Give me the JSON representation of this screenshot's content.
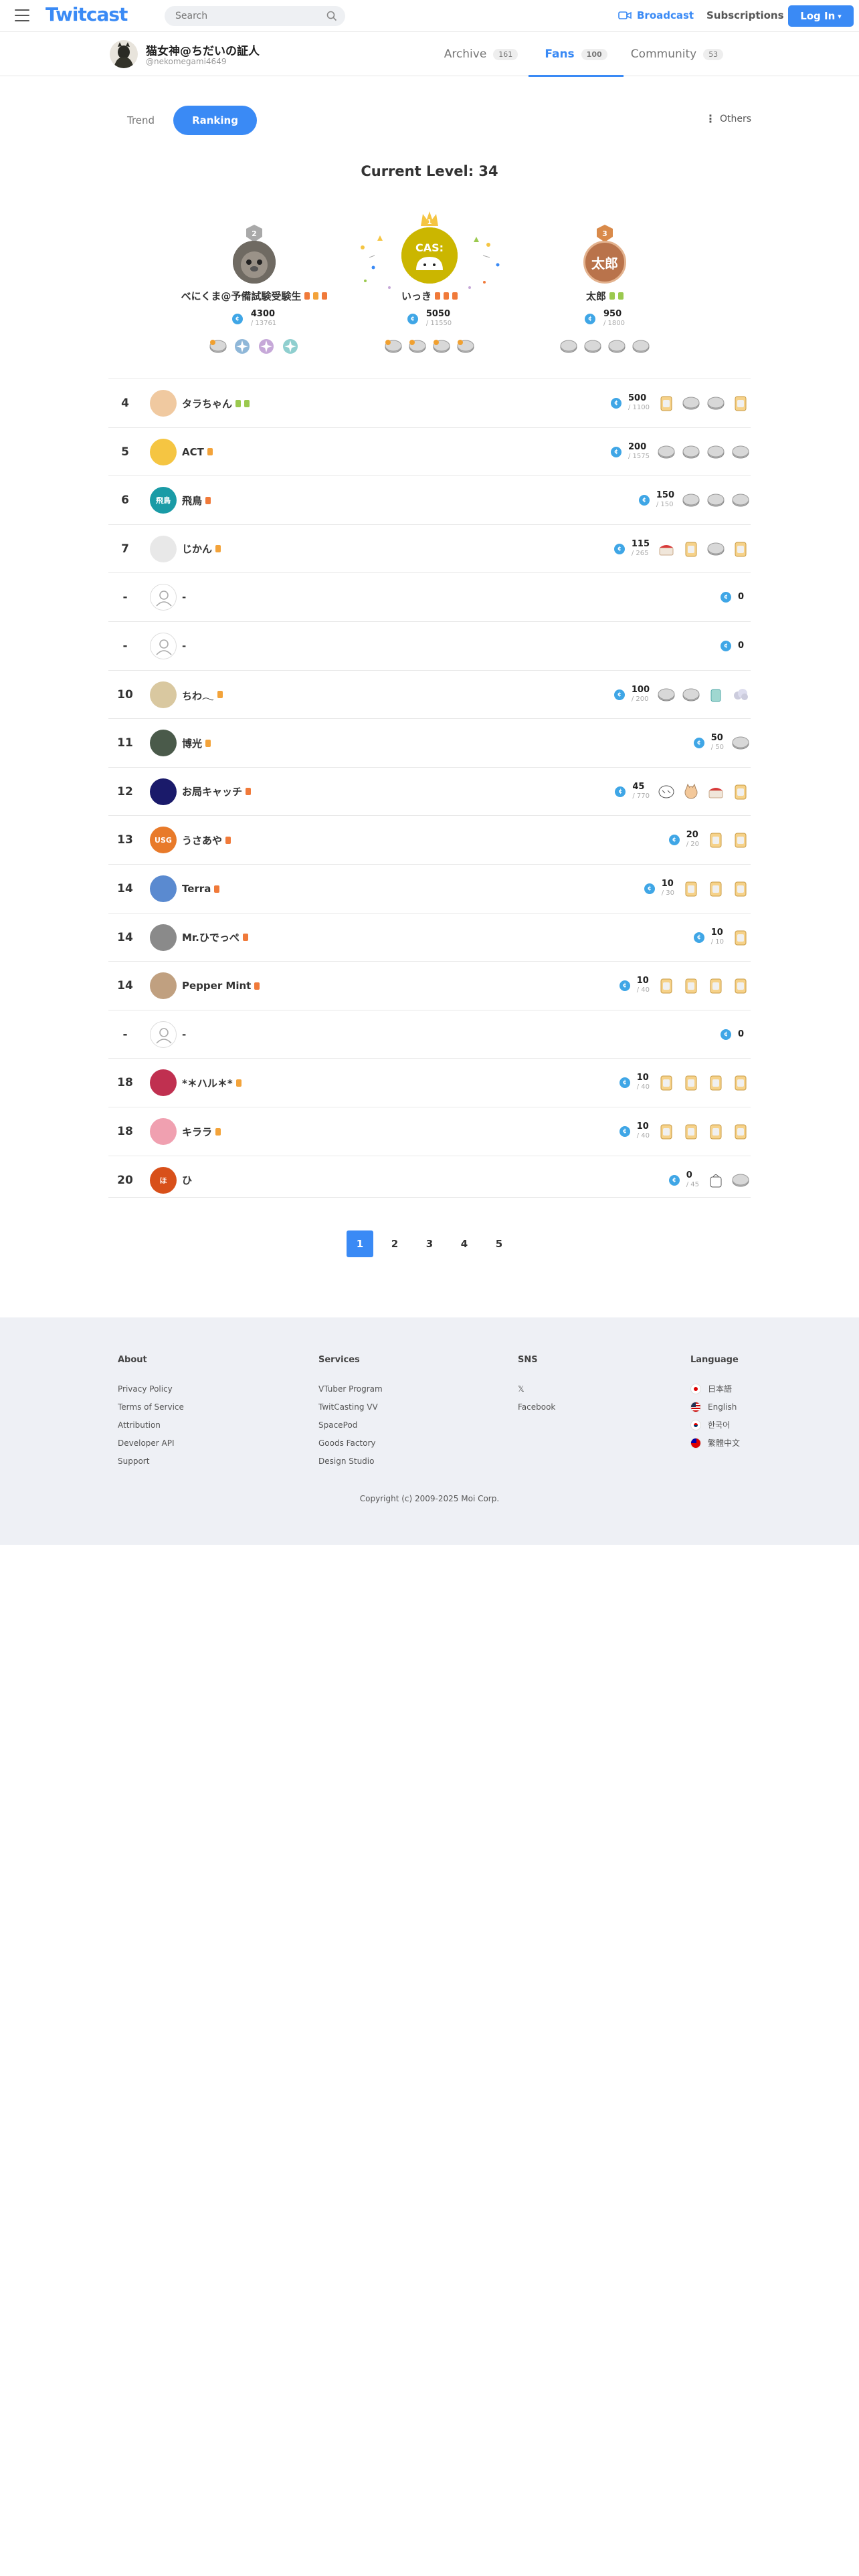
{
  "header": {
    "logo": "Twitcast",
    "search_placeholder": "Search",
    "broadcast": "Broadcast",
    "subscriptions": "Subscriptions",
    "login": "Log In",
    "login_caret": "▾"
  },
  "user": {
    "name": "猫女神@ちだいの証人",
    "id": "@nekomegami4649",
    "tabs": [
      {
        "label": "Archive",
        "count": "161"
      },
      {
        "label": "Fans",
        "count": "100"
      },
      {
        "label": "Community",
        "count": "53"
      }
    ]
  },
  "controls": {
    "trend": "Trend",
    "ranking": "Ranking",
    "others": "Others",
    "others_icon": "⋮"
  },
  "level": "Current Level: 34",
  "podium": [
    {
      "rank": "2",
      "name": "べにくま@予備試験受験生",
      "points": "4300",
      "max": "/ 13761",
      "avatar_color": "#777"
    },
    {
      "rank": "1",
      "name": "いっき",
      "points": "5050",
      "max": "/ 11550",
      "avatar_color": "#c9b400"
    },
    {
      "rank": "3",
      "name": "太郎",
      "points": "950",
      "max": "/ 1800",
      "avatar_color": "#b9734b",
      "avatar_text": "太郎"
    }
  ],
  "ranking": [
    {
      "rank": "4",
      "name": "タラちゃん",
      "points": "500",
      "max": "/ 1100",
      "avatar_color": "#f0c9a0"
    },
    {
      "rank": "5",
      "name": "ACT",
      "points": "200",
      "max": "/ 1575",
      "avatar_color": "#f5c542"
    },
    {
      "rank": "6",
      "name": "飛鳥",
      "points": "150",
      "max": "/ 150",
      "avatar_color": "#1a9ba6",
      "avatar_text": "飛鳥"
    },
    {
      "rank": "7",
      "name": "じかん",
      "points": "115",
      "max": "/ 265",
      "avatar_color": "#e8e8e8"
    },
    {
      "rank": "-",
      "name": "-",
      "points": "0",
      "max": "",
      "avatar_color": "#fff"
    },
    {
      "rank": "-",
      "name": "-",
      "points": "0",
      "max": "",
      "avatar_color": "#fff"
    },
    {
      "rank": "10",
      "name": "ちわ𓂃",
      "points": "100",
      "max": "/ 200",
      "avatar_color": "#d9c8a0"
    },
    {
      "rank": "11",
      "name": "博光",
      "points": "50",
      "max": "/ 50",
      "avatar_color": "#4a5a4a"
    },
    {
      "rank": "12",
      "name": "お局キャッチ",
      "points": "45",
      "max": "/ 770",
      "avatar_color": "#1a1a6a"
    },
    {
      "rank": "13",
      "name": "うさあや",
      "points": "20",
      "max": "/ 20",
      "avatar_color": "#e87a2a",
      "avatar_text": "USG"
    },
    {
      "rank": "14",
      "name": "Terra",
      "points": "10",
      "max": "/ 30",
      "avatar_color": "#5a8ad0"
    },
    {
      "rank": "14",
      "name": "Mr.ひでっぺ",
      "points": "10",
      "max": "/ 10",
      "avatar_color": "#8a8a8a"
    },
    {
      "rank": "14",
      "name": "Pepper Mint",
      "points": "10",
      "max": "/ 40",
      "avatar_color": "#c0a080"
    },
    {
      "rank": "-",
      "name": "-",
      "points": "0",
      "max": "",
      "avatar_color": "#fff"
    },
    {
      "rank": "18",
      "name": "*＊ハル＊*",
      "points": "10",
      "max": "/ 40",
      "avatar_color": "#c03050"
    },
    {
      "rank": "18",
      "name": "キララ",
      "points": "10",
      "max": "/ 40",
      "avatar_color": "#f0a0b0"
    },
    {
      "rank": "20",
      "name": "ひ",
      "points": "0",
      "max": "/ 45",
      "avatar_color": "#d8501a",
      "avatar_text": "ほ"
    }
  ],
  "pagination": [
    "1",
    "2",
    "3",
    "4",
    "5"
  ],
  "footer": {
    "about": {
      "title": "About",
      "links": [
        "Privacy Policy",
        "Terms of Service",
        "Attribution",
        "Developer API",
        "Support"
      ]
    },
    "services": {
      "title": "Services",
      "links": [
        "VTuber Program",
        "TwitCasting VV",
        "SpacePod",
        "Goods Factory",
        "Design Studio"
      ]
    },
    "sns": {
      "title": "SNS",
      "links": [
        "𝕏",
        "Facebook"
      ]
    },
    "language": {
      "title": "Language",
      "links": [
        "日本語",
        "English",
        "한국어",
        "繁體中文"
      ]
    },
    "copyright": "Copyright (c) 2009-2025 Moi Corp."
  },
  "colors": {
    "accent": "#3a8af5",
    "coin": "#3fa6e6",
    "footer_bg": "#eef0f5"
  }
}
